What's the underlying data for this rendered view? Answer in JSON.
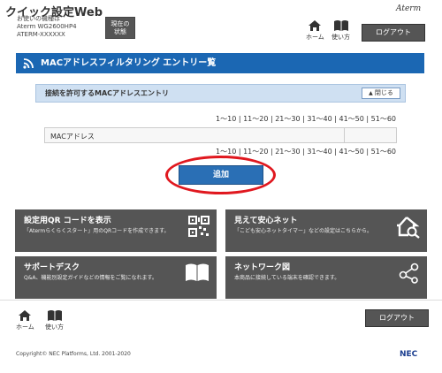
{
  "header": {
    "title": "クイック設定Web",
    "device_label": "お使いの機種は",
    "device_model": "Aterm WG2600HP4",
    "device_serial": "ATERM-XXXXXX",
    "status_button": [
      "現在の",
      "状態"
    ],
    "logo": "Aterm",
    "home_label": "ホーム",
    "manual_label": "使い方",
    "logout_label": "ログアウト"
  },
  "section": {
    "title": "MACアドレスフィルタリング エントリー覧",
    "panel_title": "接続を許可するMACアドレスエントリ",
    "close_label": "閉じる"
  },
  "pager": [
    "1～10",
    "11～20",
    "21～30",
    "31～40",
    "41～50",
    "51～60"
  ],
  "table": {
    "header": "MACアドレス"
  },
  "add_button": "追加",
  "tiles": [
    {
      "title": "設定用QR コードを表示",
      "desc": "「Atermらくらくスタート」用のQRコードを作成できます。",
      "icon": "qr-code-icon"
    },
    {
      "title": "見えて安心ネット",
      "desc": "「こども安心ネットタイマー」などの設定はこちらから。",
      "icon": "house-search-icon"
    },
    {
      "title": "サポートデスク",
      "desc": "Q&A、機能別設定ガイドなどの情報をご覧になれます。",
      "icon": "book-icon"
    },
    {
      "title": "ネットワーク図",
      "desc": "本商品に接続している端末を確認できます。",
      "icon": "network-icon"
    }
  ],
  "footer": {
    "home_label": "ホーム",
    "manual_label": "使い方",
    "logout_label": "ログアウト",
    "copyright": "Copyright© NEC Platforms, Ltd. 2001-2020",
    "nec_logo": "NEC"
  },
  "colors": {
    "accent_blue": "#1b67b3",
    "tile_gray": "#555555",
    "highlight_red": "#e0181f"
  }
}
